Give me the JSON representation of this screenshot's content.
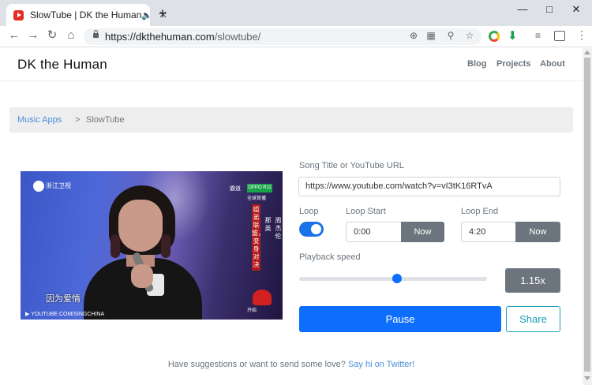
{
  "browser": {
    "tab_title": "SlowTube | DK the Human",
    "tab_audio_icon": "speaker-icon",
    "new_tab_label": "+",
    "url_host": "https://dkthehuman.com",
    "url_path": "/slowtube/"
  },
  "site": {
    "brand": "DK the Human",
    "nav": [
      "Blog",
      "Projects",
      "About"
    ]
  },
  "breadcrumb": {
    "parent": "Music Apps",
    "separator": ">",
    "current": "SlowTube"
  },
  "video": {
    "channel_logo_text": "浙江卫视",
    "corner_tag": "霸道",
    "sponsor_badge": "OPPO R11",
    "sponsor_sub": "全球首播",
    "vertical_caption_1": "姐弟联盟，变身对决",
    "vertical_caption_2": "那英",
    "vertical_caption_3": "周杰伦",
    "subtitle": "因为爱情",
    "watermark": "YOUTUBE.COM/SINGCHINA",
    "bottom_tag": "开始"
  },
  "controls": {
    "url_label": "Song Title or YouTube URL",
    "url_value": "https://www.youtube.com/watch?v=vI3tK16RTvA",
    "loop_label": "Loop",
    "loop_on": true,
    "loop_start_label": "Loop Start",
    "loop_start_value": "0:00",
    "loop_end_label": "Loop End",
    "loop_end_value": "4:20",
    "now_label": "Now",
    "playback_label": "Playback speed",
    "playback_value": "1.15x",
    "slider_fraction": 0.52,
    "pause_label": "Pause",
    "share_label": "Share"
  },
  "footer": {
    "text": "Have suggestions or want to send some love?",
    "link": "Say hi on Twitter!"
  },
  "colors": {
    "primary": "#0d6efd",
    "secondary": "#6c757d",
    "info": "#17a2b8",
    "link": "#4a90d9"
  }
}
